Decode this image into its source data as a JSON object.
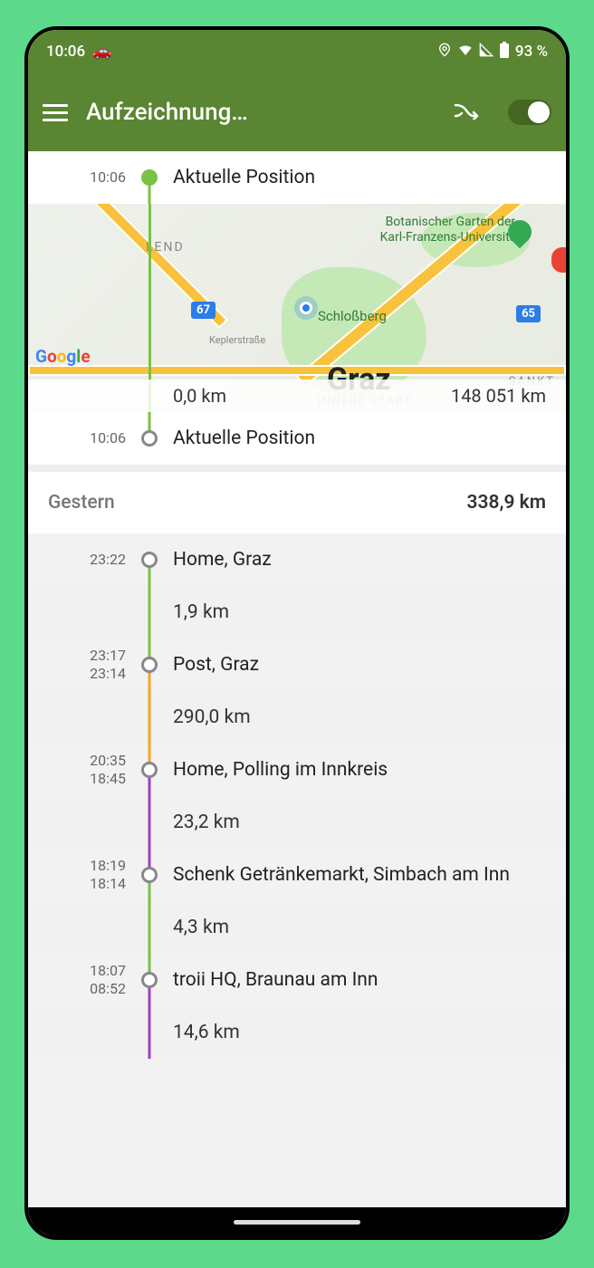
{
  "status": {
    "time": "10:06",
    "battery": "93 %"
  },
  "appbar": {
    "title": "Aufzeichnung…"
  },
  "today": {
    "current_time_top": "10:06",
    "current_label_top": "Aktuelle Position",
    "distance_segment": "0,0 km",
    "total_odo": "148 051 km",
    "current_time_bottom": "10:06",
    "current_label_bottom": "Aktuelle Position"
  },
  "map": {
    "lend": "LEND",
    "garten": "Botanischer Garten der\nKarl-Franzens-Universität",
    "schloss": "Schloßberg",
    "kepler": "Keplerstraße",
    "graz": "Graz",
    "sankt": "SANKT",
    "innere": "INNERE STADT",
    "badge67": "67",
    "badge65": "65",
    "google": "Google"
  },
  "yesterday": {
    "header": "Gestern",
    "total": "338,9 km",
    "entries": [
      {
        "time_top": "23:22",
        "time_bottom": "",
        "label": "Home, Graz",
        "line_above": "",
        "line_below": "green"
      },
      {
        "dist": "1,9 km",
        "line": "green"
      },
      {
        "time_top": "23:17",
        "time_bottom": "23:14",
        "label": "Post, Graz",
        "line_above": "green",
        "line_below": "orange"
      },
      {
        "dist": "290,0 km",
        "line": "orange"
      },
      {
        "time_top": "20:35",
        "time_bottom": "18:45",
        "label": "Home, Polling im Innkreis",
        "line_above": "orange",
        "line_below": "purple"
      },
      {
        "dist": "23,2 km",
        "line": "purple"
      },
      {
        "time_top": "18:19",
        "time_bottom": "18:14",
        "label": "Schenk Getränkemarkt, Simbach am Inn",
        "line_above": "purple",
        "line_below": "green"
      },
      {
        "dist": "4,3 km",
        "line": "green"
      },
      {
        "time_top": "18:07",
        "time_bottom": "08:52",
        "label": "troii HQ, Braunau am Inn",
        "line_above": "green",
        "line_below": "purple"
      },
      {
        "dist": "14,6 km",
        "line": "purple"
      }
    ]
  }
}
